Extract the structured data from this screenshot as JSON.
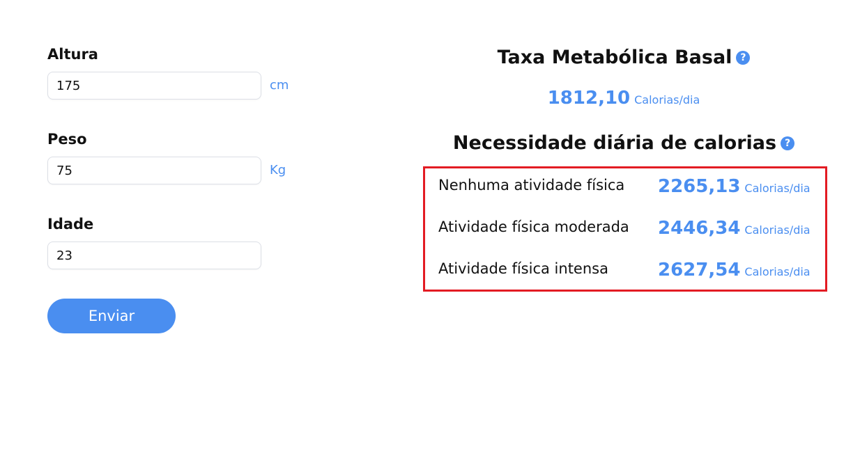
{
  "form": {
    "fields": [
      {
        "label": "Altura",
        "value": "175",
        "unit": "cm"
      },
      {
        "label": "Peso",
        "value": "75",
        "unit": "Kg"
      },
      {
        "label": "Idade",
        "value": "23",
        "unit": ""
      }
    ],
    "submit_label": "Enviar"
  },
  "results": {
    "bmr": {
      "title": "Taxa Metabólica Basal",
      "help_icon": "?",
      "value": "1812,10",
      "unit": "Calorias/dia"
    },
    "daily": {
      "title": "Necessidade diária de calorias",
      "help_icon": "?",
      "rows": [
        {
          "label": "Nenhuma atividade física",
          "value": "2265,13",
          "unit": "Calorias/dia"
        },
        {
          "label": "Atividade física moderada",
          "value": "2446,34",
          "unit": "Calorias/dia"
        },
        {
          "label": "Atividade física intensa",
          "value": "2627,54",
          "unit": "Calorias/dia"
        }
      ]
    }
  },
  "colors": {
    "accent": "#4a8ef0",
    "highlight_border": "#e31b23",
    "text": "#111111"
  }
}
